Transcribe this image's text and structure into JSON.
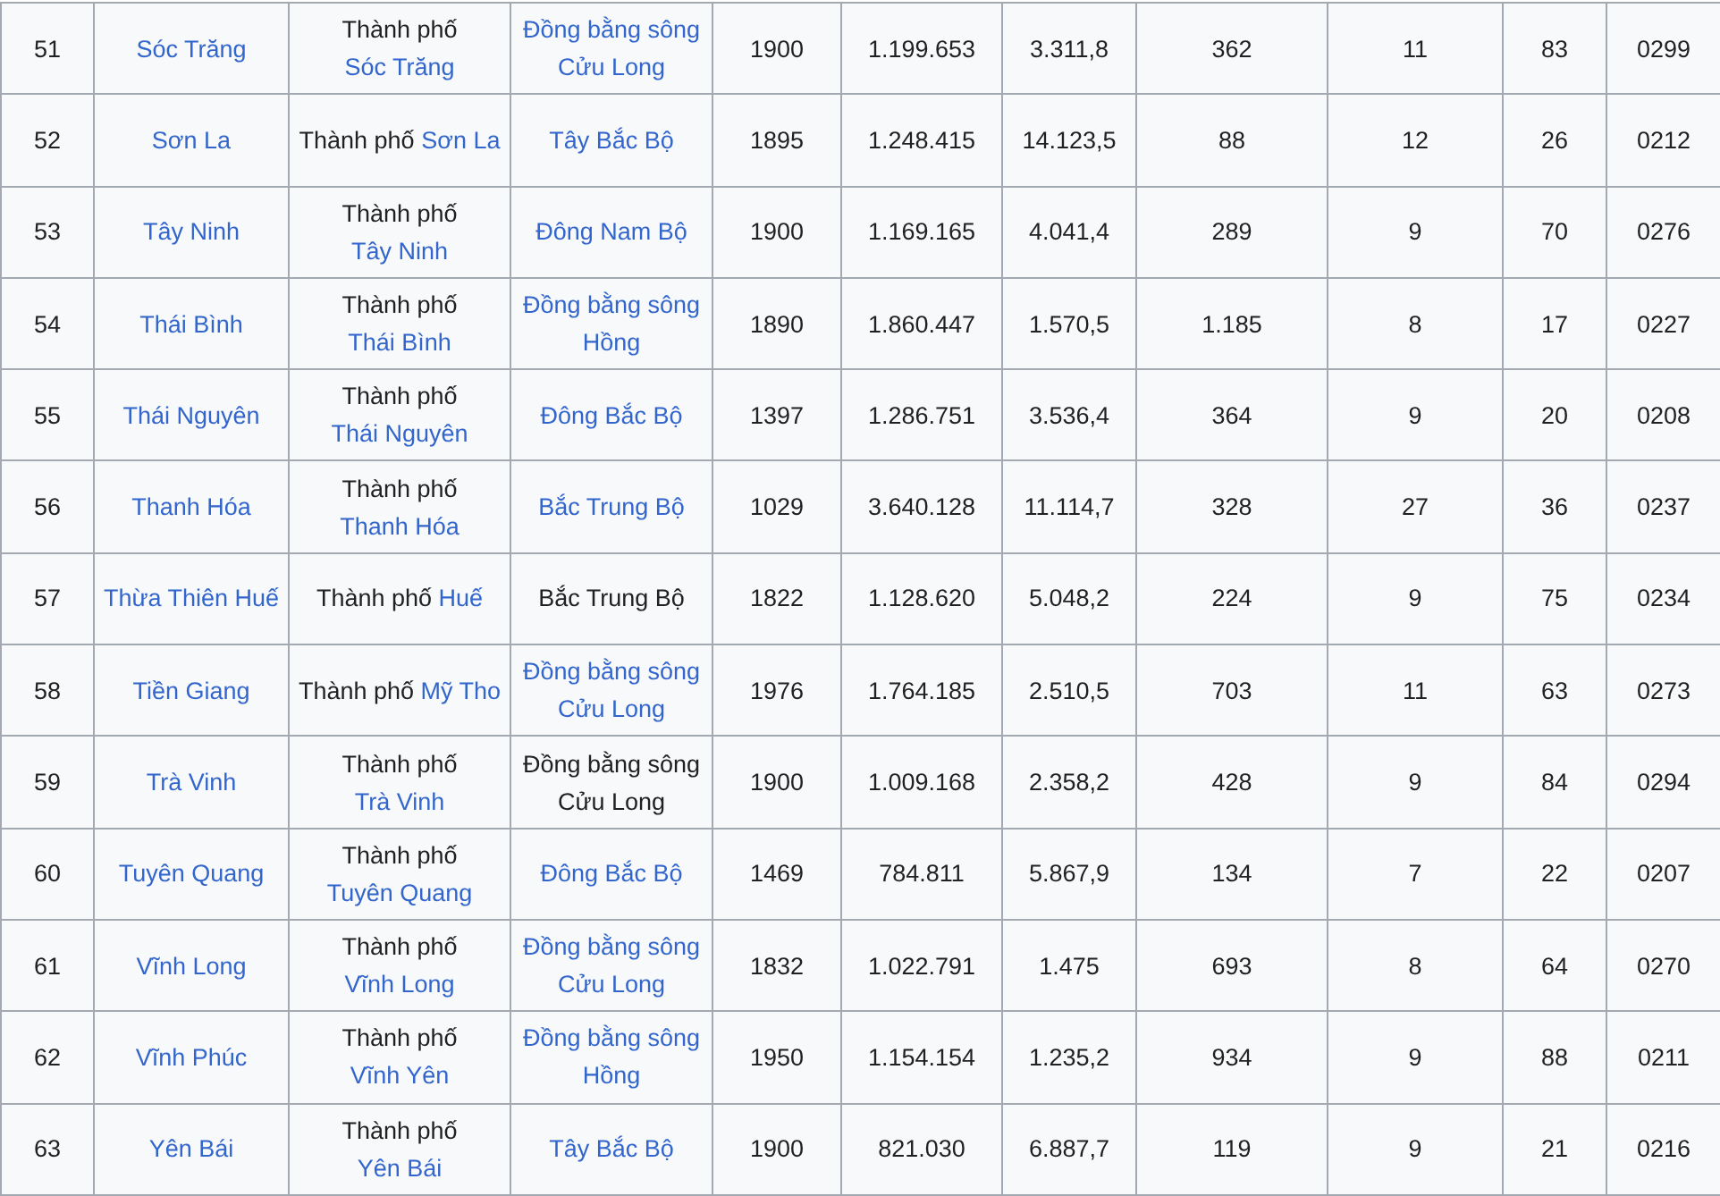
{
  "table": {
    "rows": [
      {
        "number": "51",
        "province": "Sóc Trăng",
        "capital": {
          "prefix": "Thành phố",
          "name": "Sóc Trăng"
        },
        "region": {
          "text": "Đồng bằng sông Cửu Long",
          "linked": true
        },
        "year": "1900",
        "population": "1.199.653",
        "area": "3.311,8",
        "density": "362",
        "column_9": "11",
        "column_10": "83",
        "phone_code": "0299"
      },
      {
        "number": "52",
        "province": "Sơn La",
        "capital": {
          "prefix": "Thành phố",
          "name": "Sơn La"
        },
        "region": {
          "text": "Tây Bắc Bộ",
          "linked": true
        },
        "year": "1895",
        "population": "1.248.415",
        "area": "14.123,5",
        "density": "88",
        "column_9": "12",
        "column_10": "26",
        "phone_code": "0212"
      },
      {
        "number": "53",
        "province": "Tây Ninh",
        "capital": {
          "prefix": "Thành phố",
          "name": "Tây Ninh"
        },
        "region": {
          "text": "Đông Nam Bộ",
          "linked": true
        },
        "year": "1900",
        "population": "1.169.165",
        "area": "4.041,4",
        "density": "289",
        "column_9": "9",
        "column_10": "70",
        "phone_code": "0276"
      },
      {
        "number": "54",
        "province": "Thái Bình",
        "capital": {
          "prefix": "Thành phố",
          "name": "Thái Bình"
        },
        "region": {
          "text": "Đồng bằng sông Hồng",
          "linked": true
        },
        "year": "1890",
        "population": "1.860.447",
        "area": "1.570,5",
        "density": "1.185",
        "column_9": "8",
        "column_10": "17",
        "phone_code": "0227"
      },
      {
        "number": "55",
        "province": "Thái Nguyên",
        "capital": {
          "prefix": "Thành phố",
          "name": "Thái Nguyên"
        },
        "region": {
          "text": "Đông Bắc Bộ",
          "linked": true
        },
        "year": "1397",
        "population": "1.286.751",
        "area": "3.536,4",
        "density": "364",
        "column_9": "9",
        "column_10": "20",
        "phone_code": "0208"
      },
      {
        "number": "56",
        "province": "Thanh Hóa",
        "capital": {
          "prefix": "Thành phố",
          "name": "Thanh Hóa"
        },
        "region": {
          "text": "Bắc Trung Bộ",
          "linked": true
        },
        "year": "1029",
        "population": "3.640.128",
        "area": "11.114,7",
        "density": "328",
        "column_9": "27",
        "column_10": "36",
        "phone_code": "0237"
      },
      {
        "number": "57",
        "province": "Thừa Thiên Huế",
        "capital": {
          "prefix": "Thành phố",
          "name": "Huế"
        },
        "region": {
          "text": "Bắc Trung Bộ",
          "linked": false
        },
        "year": "1822",
        "population": "1.128.620",
        "area": "5.048,2",
        "density": "224",
        "column_9": "9",
        "column_10": "75",
        "phone_code": "0234"
      },
      {
        "number": "58",
        "province": "Tiền Giang",
        "capital": {
          "prefix": "Thành phố",
          "name": "Mỹ Tho"
        },
        "region": {
          "text": "Đồng bằng sông Cửu Long",
          "linked": true
        },
        "year": "1976",
        "population": "1.764.185",
        "area": "2.510,5",
        "density": "703",
        "column_9": "11",
        "column_10": "63",
        "phone_code": "0273"
      },
      {
        "number": "59",
        "province": "Trà Vinh",
        "capital": {
          "prefix": "Thành phố",
          "name": "Trà Vinh"
        },
        "region": {
          "text": "Đồng bằng sông Cửu Long",
          "linked": false
        },
        "year": "1900",
        "population": "1.009.168",
        "area": "2.358,2",
        "density": "428",
        "column_9": "9",
        "column_10": "84",
        "phone_code": "0294"
      },
      {
        "number": "60",
        "province": "Tuyên Quang",
        "capital": {
          "prefix": "Thành phố",
          "name": "Tuyên Quang"
        },
        "region": {
          "text": "Đông Bắc Bộ",
          "linked": true
        },
        "year": "1469",
        "population": "784.811",
        "area": "5.867,9",
        "density": "134",
        "column_9": "7",
        "column_10": "22",
        "phone_code": "0207"
      },
      {
        "number": "61",
        "province": "Vĩnh Long",
        "capital": {
          "prefix": "Thành phố",
          "name": "Vĩnh Long"
        },
        "region": {
          "text": "Đồng bằng sông Cửu Long",
          "linked": true
        },
        "year": "1832",
        "population": "1.022.791",
        "area": "1.475",
        "density": "693",
        "column_9": "8",
        "column_10": "64",
        "phone_code": "0270"
      },
      {
        "number": "62",
        "province": "Vĩnh Phúc",
        "capital": {
          "prefix": "Thành phố",
          "name": "Vĩnh Yên"
        },
        "region": {
          "text": "Đồng bằng sông Hồng",
          "linked": true
        },
        "year": "1950",
        "population": "1.154.154",
        "area": "1.235,2",
        "density": "934",
        "column_9": "9",
        "column_10": "88",
        "phone_code": "0211"
      },
      {
        "number": "63",
        "province": "Yên Bái",
        "capital": {
          "prefix": "Thành phố",
          "name": "Yên Bái"
        },
        "region": {
          "text": "Tây Bắc Bộ",
          "linked": true
        },
        "year": "1900",
        "population": "821.030",
        "area": "6.887,7",
        "density": "119",
        "column_9": "9",
        "column_10": "21",
        "phone_code": "0216"
      }
    ]
  }
}
